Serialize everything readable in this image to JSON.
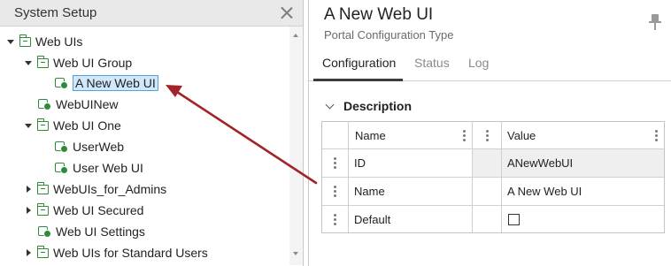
{
  "left_panel": {
    "title": "System Setup",
    "tree": [
      {
        "label": "Web UIs",
        "icon": "folder-icon",
        "expander": "expanded"
      },
      {
        "label": "Web UI Group",
        "icon": "folder-icon",
        "expander": "expanded"
      },
      {
        "label": "A New Web UI",
        "icon": "webui-icon",
        "expander": "none",
        "selected": true
      },
      {
        "label": "WebUINew",
        "icon": "webui-icon",
        "expander": "none"
      },
      {
        "label": "Web UI One",
        "icon": "folder-icon",
        "expander": "expanded"
      },
      {
        "label": "UserWeb",
        "icon": "webui-icon",
        "expander": "none"
      },
      {
        "label": "User Web UI",
        "icon": "webui-icon",
        "expander": "none"
      },
      {
        "label": "WebUIs_for_Admins",
        "icon": "folder-icon",
        "expander": "collapsed"
      },
      {
        "label": "Web UI Secured",
        "icon": "folder-icon",
        "expander": "collapsed"
      },
      {
        "label": "Web UI Settings",
        "icon": "webui-icon",
        "expander": "none"
      },
      {
        "label": "Web UIs for Standard Users",
        "icon": "folder-icon",
        "expander": "collapsed"
      }
    ]
  },
  "right_panel": {
    "title": "A New Web UI",
    "subtitle": "Portal Configuration Type",
    "tabs": [
      {
        "label": "Configuration",
        "active": true
      },
      {
        "label": "Status",
        "active": false
      },
      {
        "label": "Log",
        "active": false
      }
    ],
    "section": {
      "title": "Description",
      "columns": {
        "name": "Name",
        "value": "Value"
      },
      "rows": [
        {
          "name": "ID",
          "value": "ANewWebUI",
          "value_type": "text"
        },
        {
          "name": "Name",
          "value": "A New Web UI",
          "value_type": "text"
        },
        {
          "name": "Default",
          "value": "",
          "value_type": "checkbox",
          "checked": false
        }
      ]
    }
  },
  "colors": {
    "accent_green": "#2f8a3a",
    "selection_bg": "#cfe8fc",
    "selection_border": "#5a9fd6",
    "annotation_arrow": "#a3232b"
  }
}
